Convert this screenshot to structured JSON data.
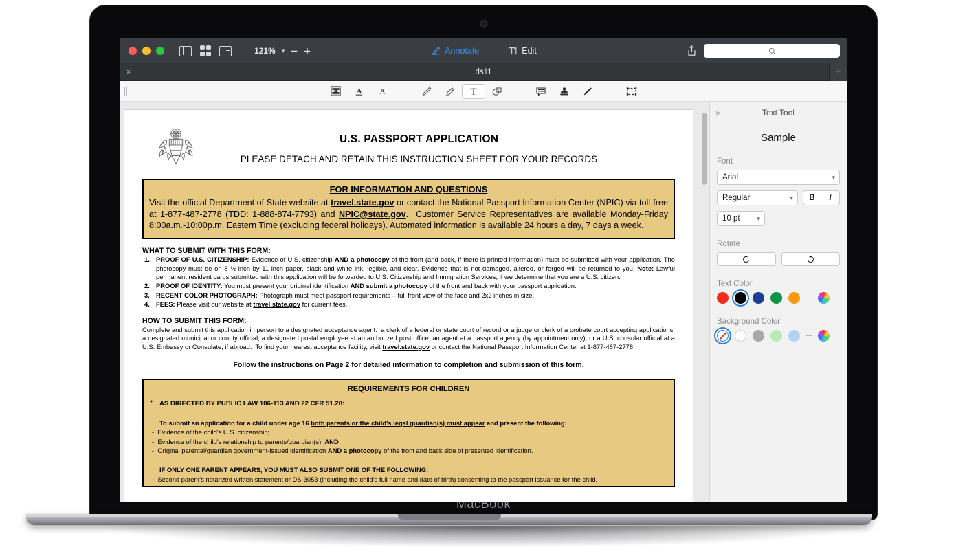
{
  "device": {
    "label": "MacBook"
  },
  "window": {
    "traffic": [
      "close-red",
      "minimize-yellow",
      "maximize-green"
    ],
    "view_icons": [
      "sidebar-view-icon",
      "grid-view-icon",
      "contact-sheet-icon"
    ],
    "zoom": {
      "value": "121%",
      "zoom_out": "−",
      "zoom_in": "+"
    },
    "center_tools": [
      {
        "label": "Annotate",
        "icon": "pen-nib-icon",
        "active": true
      },
      {
        "label": "Edit",
        "icon": "text-cursor-icon",
        "active": false
      }
    ],
    "share_icon": "share-icon",
    "search": {
      "placeholder": "",
      "value": "",
      "icon": "search-icon"
    }
  },
  "tabbar": {
    "close_label": "×",
    "title": "ds11",
    "new_tab_label": "+"
  },
  "annotation_toolbar": {
    "tools": [
      {
        "name": "redact-icon",
        "glyph": "redact"
      },
      {
        "name": "underline-text-icon",
        "glyph": "A-underline"
      },
      {
        "name": "strikethrough-text-icon",
        "glyph": "A-strike"
      },
      {
        "name": "pencil-icon",
        "glyph": "pencil"
      },
      {
        "name": "highlighter-icon",
        "glyph": "highlighter"
      },
      {
        "name": "text-tool-icon",
        "glyph": "T",
        "selected": true
      },
      {
        "name": "shapes-icon",
        "glyph": "shapes"
      },
      {
        "name": "note-icon",
        "glyph": "note"
      },
      {
        "name": "stamp-icon",
        "glyph": "stamp"
      },
      {
        "name": "signature-icon",
        "glyph": "signature"
      },
      {
        "name": "crop-select-icon",
        "glyph": "crop"
      }
    ]
  },
  "sidebar": {
    "collapse_label": "»",
    "title": "Text Tool",
    "sample_text": "Sample",
    "font_label": "Font",
    "font_family": "Arial",
    "font_style": "Regular",
    "bold_label": "B",
    "italic_label": "I",
    "font_size": "10 pt",
    "rotate_label": "Rotate",
    "rotate_ccw_icon": "rotate-counterclockwise-icon",
    "rotate_cw_icon": "rotate-clockwise-icon",
    "text_color_label": "Text Color",
    "text_colors": [
      "#f42b1e",
      "#000000",
      "#1c3f94",
      "#0f9446",
      "#fa9a14"
    ],
    "text_color_selected_index": 1,
    "background_color_label": "Background Color",
    "background_colors": [
      "none",
      "#ffffff",
      "#a8a8a8",
      "#b7ecb4",
      "#b4d2f4"
    ],
    "background_color_selected_index": 0,
    "color_wheel_icon": "color-wheel-icon"
  },
  "document": {
    "seal_icon": "us-great-seal-icon",
    "title": "U.S. PASSPORT APPLICATION",
    "subtitle": "PLEASE DETACH AND RETAIN THIS INSTRUCTION SHEET FOR YOUR RECORDS",
    "info_box": {
      "title": "FOR INFORMATION AND QUESTIONS",
      "body_html": "Visit the official Department of State website at <u class=\"b\">travel.state.gov</u> or contact the National Passport Information Center (NPIC) via toll-free at 1-877-487-2778 (TDD: 1-888-874-7793) and <u class=\"b\">NPIC@state.gov</u>.&nbsp; Customer Service Representatives are available Monday-Friday 8:00a.m.-10:00p.m. Eastern Time (excluding federal holidays). Automated information is available 24 hours a day, 7 days a week."
    },
    "what_to_submit": {
      "heading": "WHAT TO SUBMIT WITH THIS FORM:",
      "items": [
        {
          "n": "1.",
          "html": "<span class=\"bold\">PROOF OF U.S. CITIZENSHIP:</span> Evidence of U.S. citizenship <u class=\"b\">AND a photocopy</u> of the front (and back, if there is printed information) must be submitted with your application. The photocopy must be on 8 ½ inch by 11 inch paper, black and white ink, legible, and clear. Evidence that is not damaged, altered, or forged will be returned to you. <span class=\"bold\">Note:</span> Lawful permanent resident cards submitted with this application will be forwarded to U.S. Citizenship and Immigration Services, if we determine that you are a U.S. citizen."
        },
        {
          "n": "2.",
          "html": "<span class=\"bold\">PROOF OF IDENTITY:</span> You must present your original identification <u class=\"b\">AND submit a photocopy</u> of the front and back with your passport application."
        },
        {
          "n": "3.",
          "html": "<span class=\"bold\">RECENT COLOR PHOTOGRAPH:</span> Photograph must meet passport requirements – full front view of the face and 2x2 inches in size."
        },
        {
          "n": "4.",
          "html": "<span class=\"bold\">FEES:</span> Please visit our website at <u class=\"b\">travel.state.gov</u> for current fees."
        }
      ]
    },
    "how_to_submit": {
      "heading": "HOW TO SUBMIT THIS FORM:",
      "body_html": "Complete and submit this application in person to a designated acceptance agent:&nbsp; a clerk of a federal or state court of record or a judge or clerk of a probate court accepting applications; a designated municipal or county official; a designated postal employee at an authorized post office; an agent at a passport agency (by appointment only); or a U.S. consular official at a U.S. Embassy or Consulate, if abroad.&nbsp; To find your nearest acceptance facility, visit <u class=\"b\">travel.state.gov</u> or contact the National Passport Information Center at 1-877-487-2778.",
      "follow_line": "Follow the instructions on Page 2 for detailed information to completion and submission of this form."
    },
    "children_box": {
      "title": "REQUIREMENTS FOR CHILDREN",
      "bullet": "AS DIRECTED BY PUBLIC LAW 106-113 AND 22 CFR 51.28:",
      "lead_html": "To submit an application for a child under age 16 <u class=\"b\">both parents or the child's legal guardian(s) must appear</u> and present the following:",
      "dashes": [
        "Evidence of the child's U.S. citizenship;",
        "Evidence of the child's relationship to parents/guardian(s); <span class=\"bold\">AND</span>",
        "Original parental/guardian government-issued identification <u class=\"b\">AND a photocopy</u> of the front and back side of presented identification."
      ],
      "lead2": "IF ONLY ONE PARENT APPEARS, YOU MUST ALSO SUBMIT ONE OF THE FOLLOWING:",
      "dashes2": [
        "Second parent's notarized written statement or DS-3053 (including the child's full name and date of birth) consenting to the passport issuance for the child."
      ]
    }
  }
}
